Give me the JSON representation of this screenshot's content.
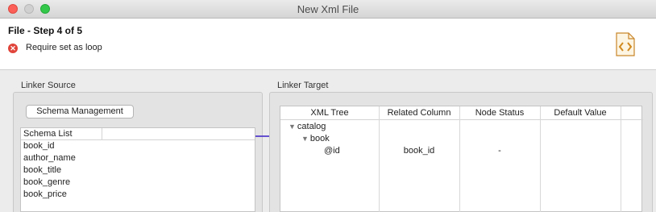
{
  "window": {
    "title": "New Xml File"
  },
  "header": {
    "step_title": "File - Step 4 of 5",
    "error_message": "Require set as loop"
  },
  "source": {
    "group_label": "Linker Source",
    "schema_button": "Schema Management",
    "list_header": "Schema List",
    "items": [
      "book_id",
      "author_name",
      "book_title",
      "book_genre",
      "book_price"
    ]
  },
  "target": {
    "group_label": "Linker Target",
    "columns": [
      "XML Tree",
      "Related Column",
      "Node Status",
      "Default Value"
    ],
    "rows": [
      {
        "node": "catalog",
        "related": "",
        "status": ""
      },
      {
        "node": "book",
        "related": "",
        "status": ""
      },
      {
        "node": "@id",
        "related": "book_id",
        "status": "-"
      }
    ]
  },
  "colors": {
    "error": "#e0443a",
    "arrow": "#3a1fc7",
    "file_icon_accent": "#e09a2a"
  },
  "icons": {
    "error": "error-circle-icon",
    "file": "xml-file-icon",
    "expand": "triangle-down-icon",
    "link": "arrow-right-icon"
  }
}
